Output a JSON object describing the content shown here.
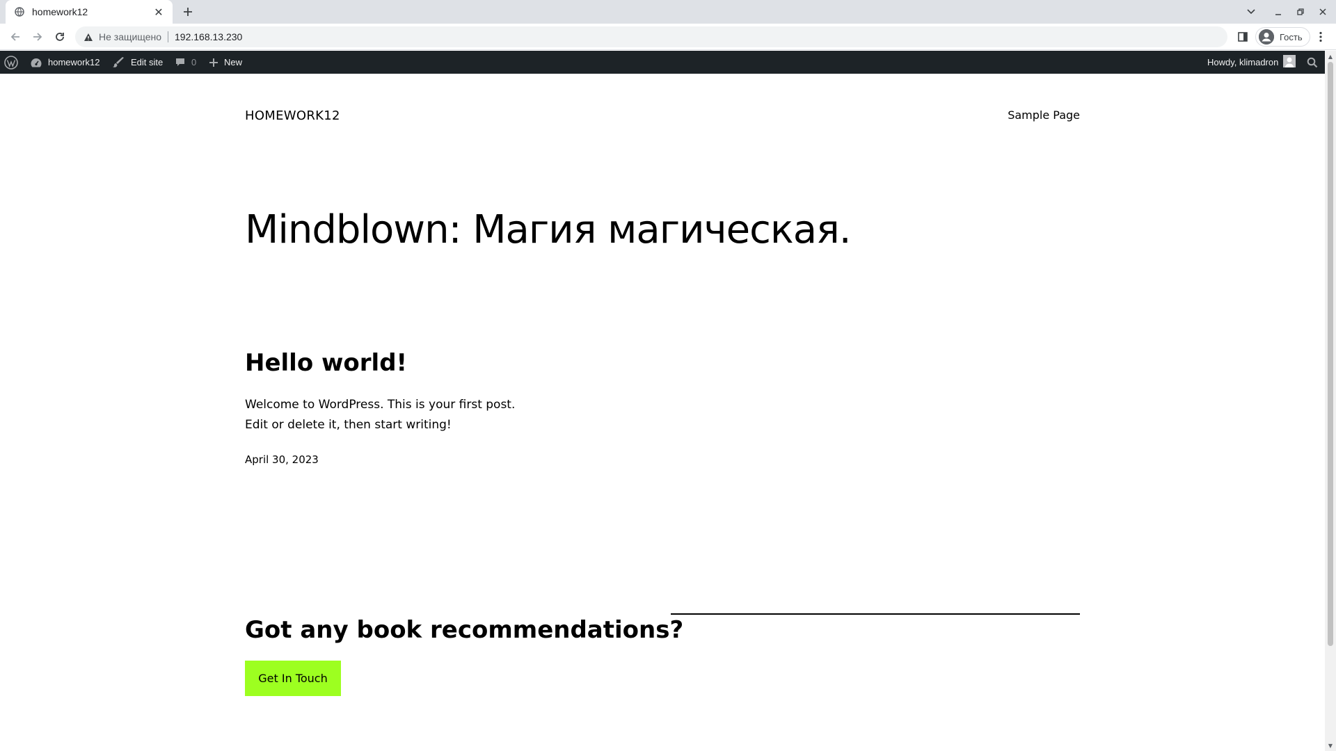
{
  "browser": {
    "tab_title": "homework12",
    "security_label": "Не защищено",
    "url": "192.168.13.230",
    "profile_name": "Гость"
  },
  "adminbar": {
    "site_name": "homework12",
    "edit_site": "Edit site",
    "comments_count": "0",
    "new_label": "New",
    "greeting": "Howdy, klimadron"
  },
  "site": {
    "title": "HOMEWORK12",
    "nav_link": "Sample Page"
  },
  "hero": {
    "heading": "Mindblown: Магия магическая."
  },
  "post": {
    "title": "Hello world!",
    "excerpt_line1": "Welcome to WordPress. This is your first post.",
    "excerpt_line2": "Edit or delete it, then start writing!",
    "date": "April 30, 2023"
  },
  "cta": {
    "heading": "Got any book recommendations?",
    "button_label": "Get In Touch",
    "button_color": "#9dff20"
  },
  "icons": [
    "globe-icon",
    "close-icon",
    "plus-icon",
    "back-icon",
    "forward-icon",
    "reload-icon",
    "warning-icon",
    "sidepanel-icon",
    "profile-icon",
    "more-icon",
    "wordpress-icon",
    "dashboard-icon",
    "brush-icon",
    "comment-icon",
    "plus-icon",
    "avatar-icon",
    "search-icon"
  ]
}
